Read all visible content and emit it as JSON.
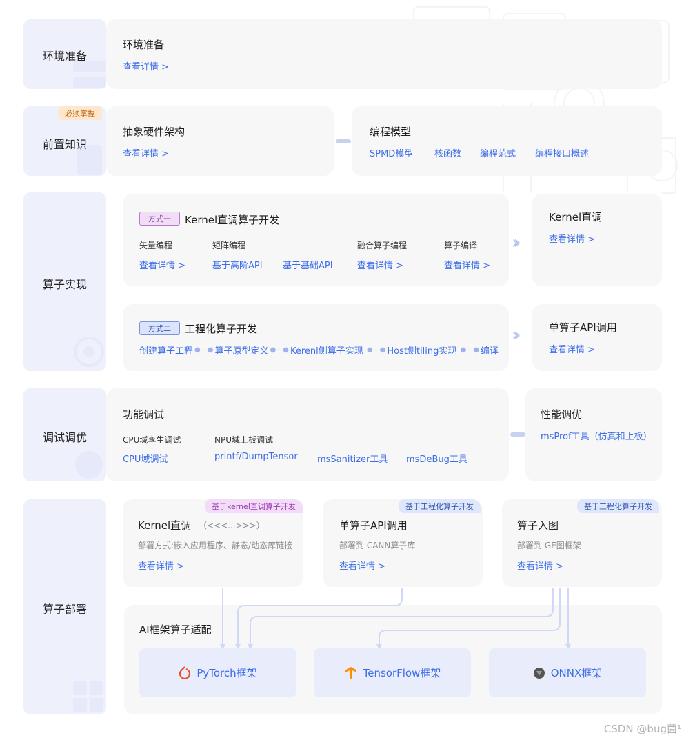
{
  "stages": {
    "env": "环境准备",
    "prereq": "前置知识",
    "impl": "算子实现",
    "debug": "调试调优",
    "deploy": "算子部署"
  },
  "env_card": {
    "title": "环境准备",
    "link": "查看详情 >"
  },
  "prereq": {
    "tag": "必须掌握",
    "hw_title": "抽象硬件架构",
    "hw_link": "查看详情 >",
    "prog_title": "编程模型",
    "prog_links": [
      "SPMD模型",
      "核函数",
      "编程范式",
      "编程接口概述"
    ]
  },
  "impl": {
    "method1_tag": "方式一",
    "method1_title": "Kernel直调算子开发",
    "cols": {
      "vector": "矢量编程",
      "matrix": "矩阵编程",
      "fusion": "融合算子编程",
      "compile": "算子编译"
    },
    "row1_links": [
      "查看详情 >",
      "基于高阶API",
      "基于基础API",
      "查看详情 >",
      "查看详情 >"
    ],
    "kernel_card_title": "Kernel直调",
    "kernel_card_link": "查看详情 >",
    "method2_tag": "方式二",
    "method2_title": "工程化算子开发",
    "flow": [
      "创建算子工程",
      "算子原型定义",
      "Kerenl侧算子实现",
      "Host侧tiling实现",
      "编译"
    ],
    "api_card_title": "单算子API调用",
    "api_card_link": "查看详情 >"
  },
  "debug": {
    "func_title": "功能调试",
    "cpu_label": "CPU域孪生调试",
    "npu_label": "NPU域上板调试",
    "links": [
      "CPU域调试",
      "printf/DumpTensor",
      "msSanitizer工具",
      "msDeBug工具"
    ],
    "perf_title": "性能调优",
    "perf_link": "msProf工具（仿真和上板）"
  },
  "deploy": {
    "cards": [
      {
        "tag": "基于kernel直调算子开发",
        "title": "Kernel直调",
        "extra": "（<<<...>>>）",
        "desc": "部署方式:嵌入应用程序、静态/动态库链接",
        "link": "查看详情 >"
      },
      {
        "tag": "基于工程化算子开发",
        "title": "单算子API调用",
        "extra": "",
        "desc": "部署到 CANN算子库",
        "link": "查看详情 >"
      },
      {
        "tag": "基于工程化算子开发",
        "title": "算子入图",
        "extra": "",
        "desc": "部署到 GE图框架",
        "link": "查看详情 >"
      }
    ],
    "ai_title": "AI框架算子适配",
    "frameworks": [
      "PyTorch框架",
      "TensorFlow框架",
      "ONNX框架"
    ]
  },
  "watermark": "CSDN @bug菌¹",
  "colors": {
    "accent": "#3d6ee8",
    "stage_bg": "#eef0fb",
    "card_bg": "#f7f7f8"
  }
}
